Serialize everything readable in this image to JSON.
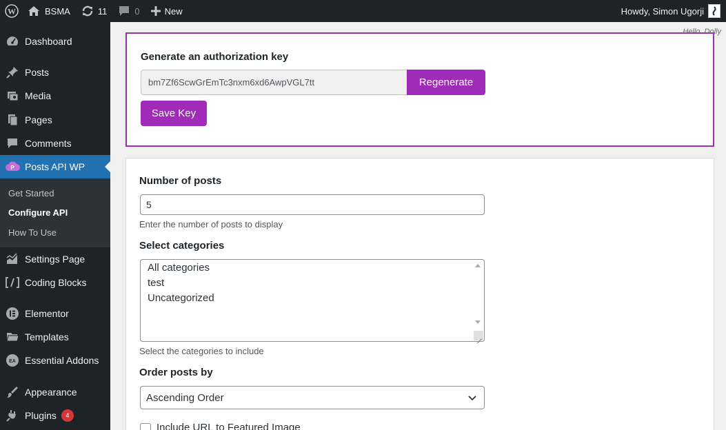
{
  "adminbar": {
    "site_name": "BSMA",
    "updates_count": "11",
    "comments_count": "0",
    "new_label": "New",
    "greeting": "Howdy, Simon Ugorji"
  },
  "sidebar": {
    "items": [
      {
        "label": "Dashboard",
        "icon": "dashboard-icon"
      },
      {
        "label": "Posts",
        "icon": "pin-icon"
      },
      {
        "label": "Media",
        "icon": "media-icon"
      },
      {
        "label": "Pages",
        "icon": "pages-icon"
      },
      {
        "label": "Comments",
        "icon": "comments-icon"
      },
      {
        "label": "Posts API WP",
        "icon": "posts-api-icon"
      },
      {
        "label": "Settings Page",
        "icon": "settings-chart-icon"
      },
      {
        "label": "Coding Blocks",
        "icon": "code-brackets-icon"
      },
      {
        "label": "Elementor",
        "icon": "elementor-icon"
      },
      {
        "label": "Templates",
        "icon": "folder-icon"
      },
      {
        "label": "Essential Addons",
        "icon": "ea-icon"
      },
      {
        "label": "Appearance",
        "icon": "brush-icon"
      },
      {
        "label": "Plugins",
        "icon": "plugin-icon"
      }
    ],
    "submenu": [
      "Get Started",
      "Configure API",
      "How To Use"
    ],
    "plugins_badge": "4"
  },
  "hello_dolly": "Hello, Dolly",
  "auth": {
    "title": "Generate an authorization key",
    "key_value": "bm7Zf6ScwGrEmTc3nxm6xd6AwpVGL7tt",
    "regenerate_label": "Regenerate",
    "save_label": "Save Key"
  },
  "settings": {
    "num_posts_label": "Number of posts",
    "num_posts_value": "5",
    "num_posts_desc": "Enter the number of posts to display",
    "categories_label": "Select categories",
    "categories": [
      "All categories",
      "test",
      "Uncategorized"
    ],
    "categories_desc": "Select the categories to include",
    "order_label": "Order posts by",
    "order_value": "Ascending Order",
    "featured_label": "Include URL to Featured Image"
  },
  "colors": {
    "accent": "#a02bb8",
    "admin_dark": "#1d2327",
    "menu_current": "#2271b1"
  }
}
